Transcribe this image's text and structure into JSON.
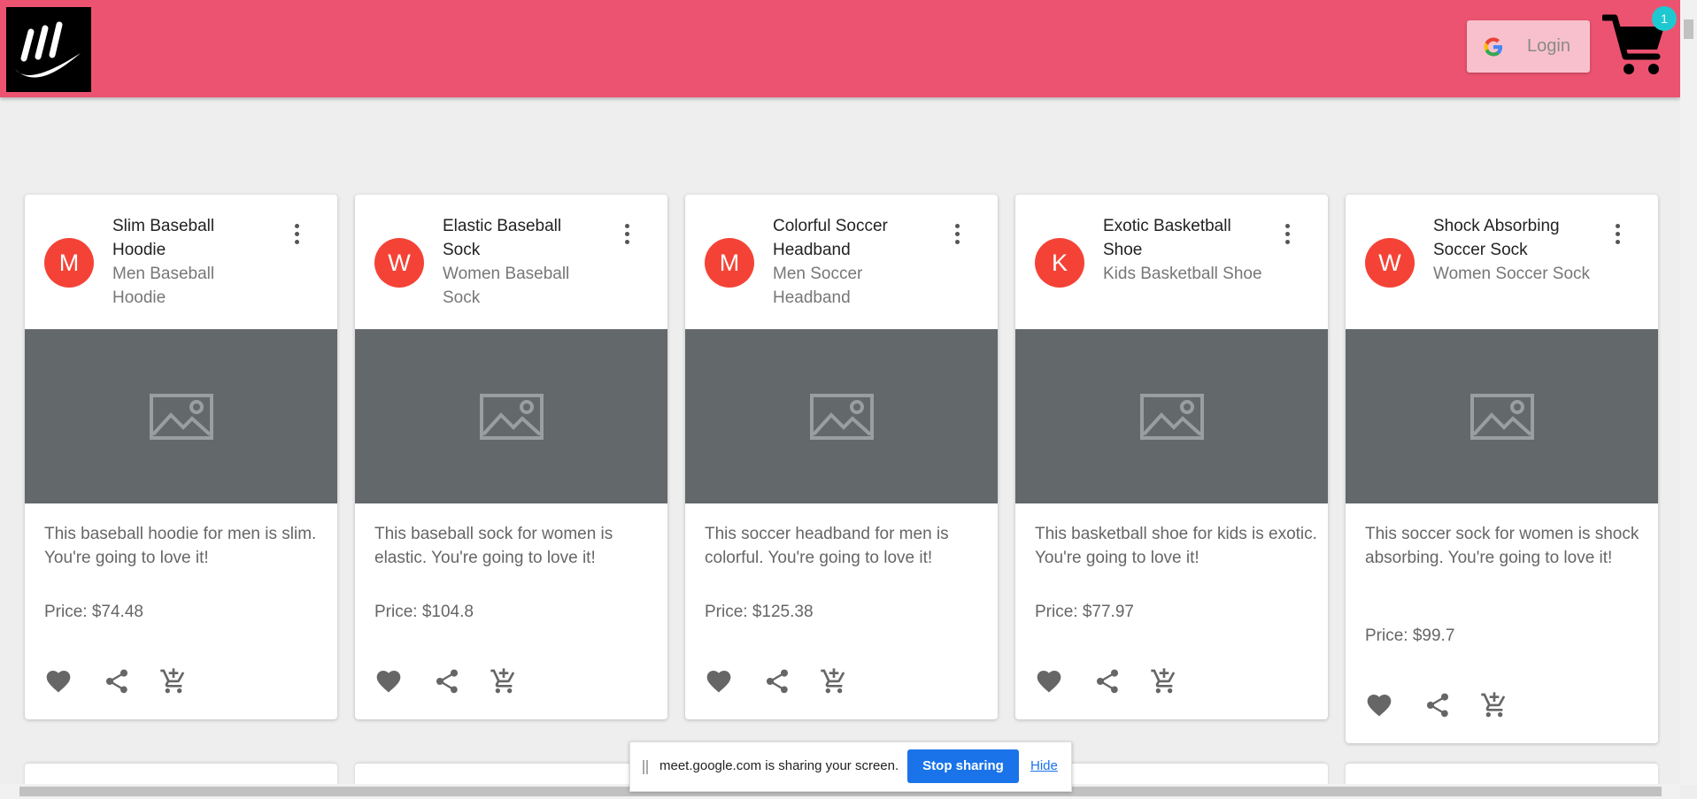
{
  "header": {
    "login_label": "Login",
    "cart_count": "1",
    "brand_color": "#ec5370"
  },
  "products": [
    {
      "avatar": "M",
      "title": "Slim Baseball Hoodie",
      "subtitle": "Men Baseball Hoodie",
      "description": "This baseball hoodie for men is slim. You're going to love it!",
      "price": "Price: $74.48"
    },
    {
      "avatar": "W",
      "title": "Elastic Baseball Sock",
      "subtitle": "Women Baseball Sock",
      "description": "This baseball sock for women is elastic. You're going to love it!",
      "price": "Price: $104.8"
    },
    {
      "avatar": "M",
      "title": "Colorful Soccer Headband",
      "subtitle": "Men Soccer Headband",
      "description": "This soccer headband for men is colorful. You're going to love it!",
      "price": "Price: $125.38"
    },
    {
      "avatar": "K",
      "title": "Exotic Basketball Shoe",
      "subtitle": "Kids Basketball Shoe",
      "description": "This basketball shoe for kids is exotic. You're going to love it!",
      "price": "Price: $77.97"
    },
    {
      "avatar": "W",
      "title": "Shock Absorbing Soccer Sock",
      "subtitle": "Women Soccer Sock",
      "description": "This soccer sock for women is shock absorbing. You're going to love it!",
      "price": "Price: $99.7"
    }
  ],
  "share_bar": {
    "message": "meet.google.com is sharing your screen.",
    "stop_label": "Stop sharing",
    "hide_label": "Hide"
  }
}
